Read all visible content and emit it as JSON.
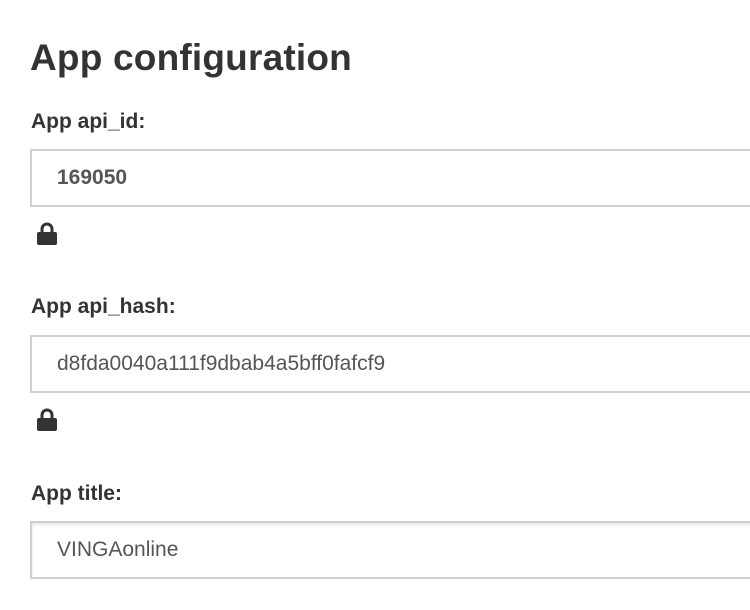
{
  "page": {
    "title": "App configuration"
  },
  "fields": [
    {
      "label": "App api_id:",
      "value": "169050",
      "locked": true,
      "icon": "lock-icon"
    },
    {
      "label": "App api_hash:",
      "value": "d8fda0040a111f9dbab4a5bff0fafcf9",
      "locked": true,
      "icon": "lock-icon"
    },
    {
      "label": "App title:",
      "value": "VINGAonline",
      "locked": false
    }
  ],
  "colors": {
    "text": "#333333",
    "value_text": "#555555",
    "border": "#d0d0d0",
    "background": "#ffffff"
  }
}
